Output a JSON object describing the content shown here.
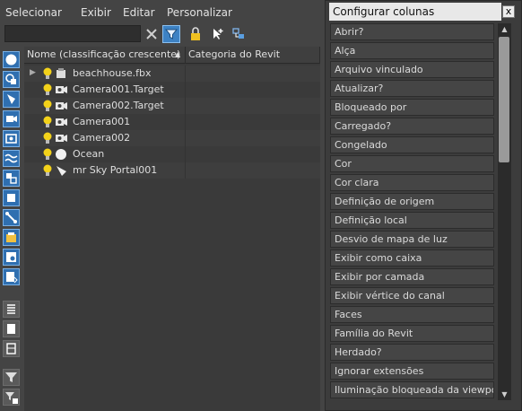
{
  "menu": [
    "Selecionar",
    "Exibir",
    "Editar",
    "Personalizar"
  ],
  "search": {
    "value": ""
  },
  "columns": {
    "name": "Nome (classificação crescente)",
    "sort_indicator": "▲",
    "category": "Categoria do Revit"
  },
  "rows": [
    {
      "name": "beachhouse.fbx",
      "icon": "container-icon",
      "expand": "▶"
    },
    {
      "name": "Camera001.Target",
      "icon": "camera-target-icon"
    },
    {
      "name": "Camera002.Target",
      "icon": "camera-target-icon"
    },
    {
      "name": "Camera001",
      "icon": "camera-icon"
    },
    {
      "name": "Camera002",
      "icon": "camera-icon"
    },
    {
      "name": "Ocean",
      "icon": "sphere-icon"
    },
    {
      "name": "mr Sky Portal001",
      "icon": "light-icon"
    }
  ],
  "panel": {
    "title": "Configurar colunas",
    "close": "x",
    "items": [
      "Abrir?",
      "Alça",
      "Arquivo vinculado",
      "Atualizar?",
      "Bloqueado por",
      "Carregado?",
      "Congelado",
      "Cor",
      "Cor clara",
      "Definição de origem",
      "Definição local",
      "Desvio de mapa de luz",
      "Exibir como caixa",
      "Exibir por camada",
      "Exibir vértice do canal",
      "Faces",
      "Família do Revit",
      "Herdado?",
      "Ignorar extensões",
      "Iluminação bloqueada da viewport"
    ]
  },
  "colors": {
    "accent": "#3d82c4",
    "panel_title_bg": "#e8e8e8",
    "bulb": "#f3d21a"
  }
}
